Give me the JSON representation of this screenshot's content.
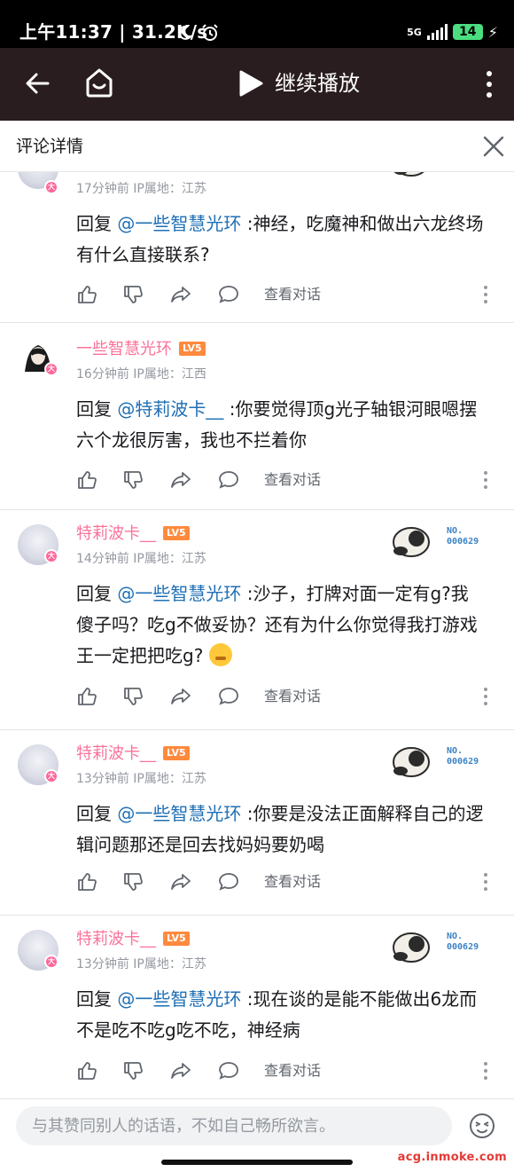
{
  "status_bar": {
    "time": "上午11:37 | 31.2K/s",
    "network": "5G",
    "battery": "14"
  },
  "app_bar": {
    "play_label": "继续播放"
  },
  "header": {
    "title": "评论详情"
  },
  "comments": [
    {
      "username": "",
      "level": "",
      "meta": "17分钟前 IP属地：江苏",
      "reply_prefix": "回复 ",
      "mention": "@一些智慧光环",
      "text": " :神经，吃魔神和做出六龙终场有什么直接联系?",
      "fan_no": [
        "000629"
      ],
      "view_conversation": "查看对话"
    },
    {
      "username": "一些智慧光环",
      "level": "LV5",
      "meta": "16分钟前 IP属地：江西",
      "reply_prefix": "回复 ",
      "mention": "@特莉波卡__",
      "text": " :你要觉得顶g光子轴银河眼嗯摆六个龙很厉害，我也不拦着你",
      "view_conversation": "查看对话"
    },
    {
      "username": "特莉波卡__",
      "level": "LV5",
      "meta": "14分钟前 IP属地：江苏",
      "reply_prefix": "回复 ",
      "mention": "@一些智慧光环",
      "text": " :沙子，打牌对面一定有g?我傻子吗？吃g不做妥协？还有为什么你觉得我打游戏王一定把把吃g?",
      "fan_no": [
        "NO.",
        "000629"
      ],
      "view_conversation": "查看对话"
    },
    {
      "username": "特莉波卡__",
      "level": "LV5",
      "meta": "13分钟前 IP属地：江苏",
      "reply_prefix": "回复 ",
      "mention": "@一些智慧光环",
      "text": " :你要是没法正面解释自己的逻辑问题那还是回去找妈妈要奶喝",
      "fan_no": [
        "NO.",
        "000629"
      ],
      "view_conversation": "查看对话"
    },
    {
      "username": "特莉波卡__",
      "level": "LV5",
      "meta": "13分钟前 IP属地：江苏",
      "reply_prefix": "回复 ",
      "mention": "@一些智慧光环",
      "text": " :现在谈的是能不能做出6龙而不是吃不吃g吃不吃，神经病",
      "fan_no": [
        "NO.",
        "000629"
      ],
      "view_conversation": "查看对话"
    }
  ],
  "avatar_badge": "大",
  "input": {
    "placeholder": "与其赞同别人的话语，不如自己畅所欲言。"
  },
  "watermark": "acg.inmoke.com",
  "colors": {
    "accent_pink": "#fb7299",
    "mention_blue": "#1e6fb5",
    "level_orange": "#ff8a3d",
    "app_bar": "#2a1d1f"
  }
}
